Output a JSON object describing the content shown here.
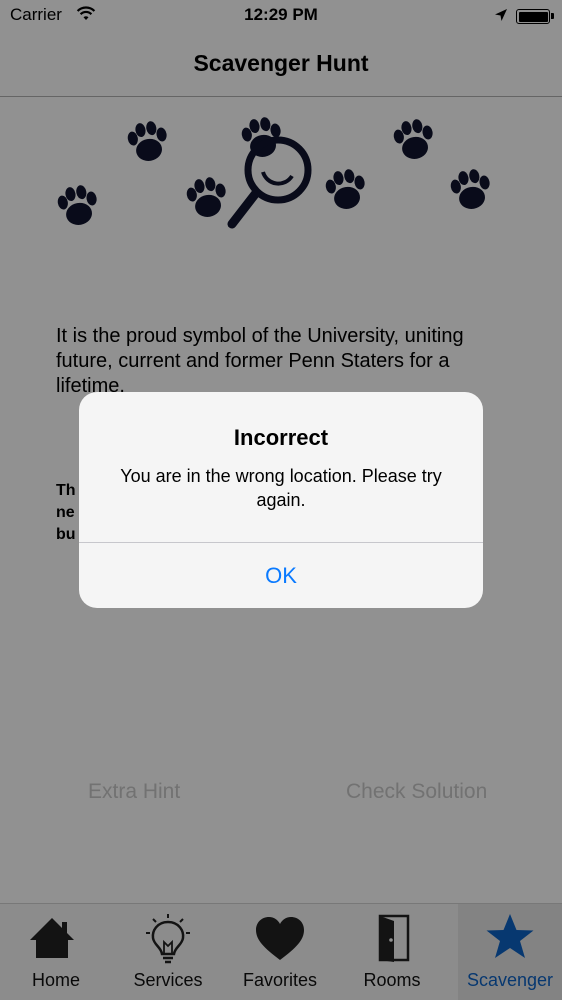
{
  "status_bar": {
    "carrier": "Carrier",
    "time": "12:29 PM"
  },
  "nav": {
    "title": "Scavenger Hunt"
  },
  "content": {
    "clue": "It is the proud symbol of the University, uniting future, current and former Penn Staters for a lifetime.",
    "hint_visible_fragments": [
      "Th",
      "ne",
      "bu"
    ],
    "extra_hint_label": "Extra Hint",
    "check_solution_label": "Check Solution"
  },
  "tabs": [
    {
      "label": "Home",
      "icon": "home-icon",
      "active": false
    },
    {
      "label": "Services",
      "icon": "lightbulb-icon",
      "active": false
    },
    {
      "label": "Favorites",
      "icon": "heart-icon",
      "active": false
    },
    {
      "label": "Rooms",
      "icon": "door-icon",
      "active": false
    },
    {
      "label": "Scavenger",
      "icon": "star-icon",
      "active": true
    }
  ],
  "alert": {
    "title": "Incorrect",
    "message": "You are in the wrong location. Please try again.",
    "ok_label": "OK"
  },
  "colors": {
    "accent": "#0a7aff",
    "active_tab": "#0e63c6",
    "paw": "#10152e",
    "disabled_button": "#c9c9c9"
  }
}
